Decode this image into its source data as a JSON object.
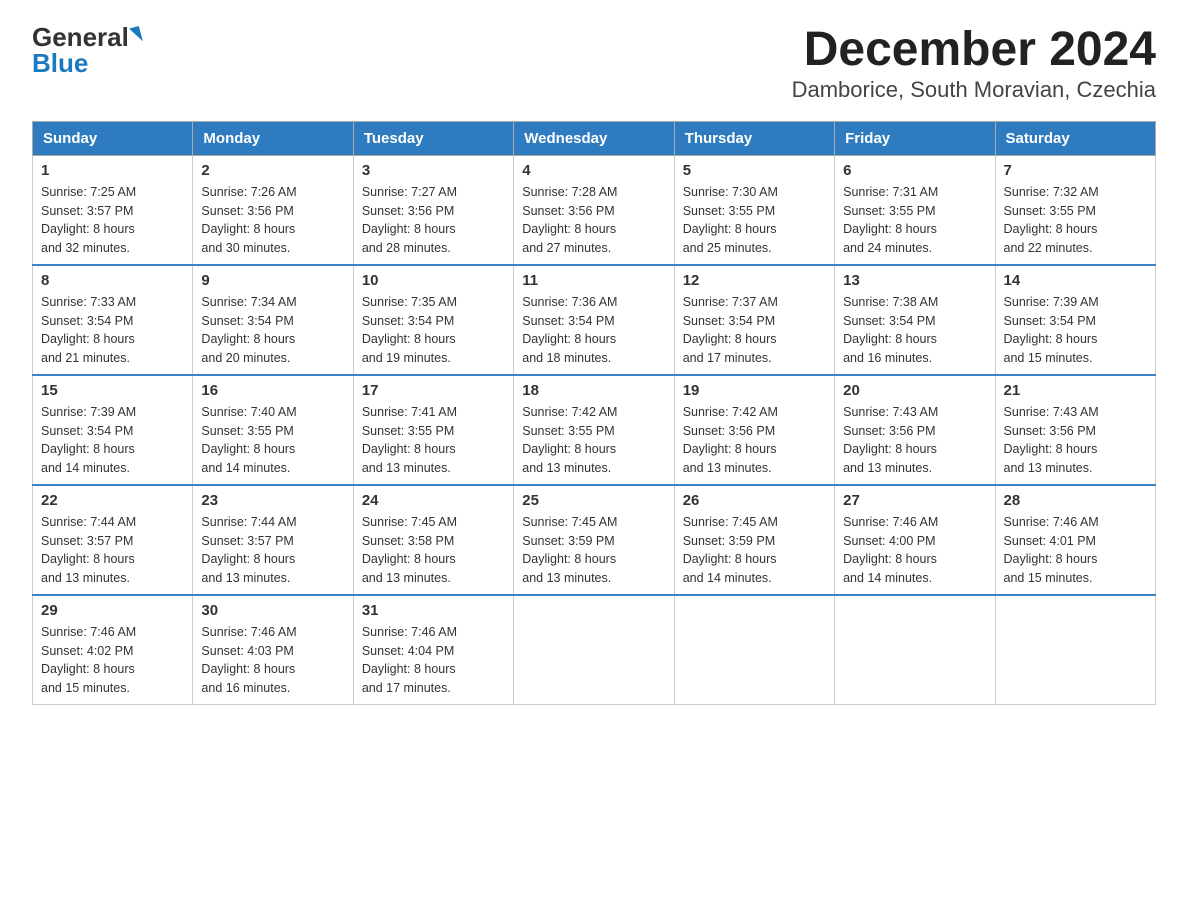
{
  "logo": {
    "general": "General",
    "blue": "Blue"
  },
  "title": "December 2024",
  "subtitle": "Damborice, South Moravian, Czechia",
  "weekdays": [
    "Sunday",
    "Monday",
    "Tuesday",
    "Wednesday",
    "Thursday",
    "Friday",
    "Saturday"
  ],
  "weeks": [
    [
      {
        "day": "1",
        "sunrise": "7:25 AM",
        "sunset": "3:57 PM",
        "daylight": "8 hours and 32 minutes."
      },
      {
        "day": "2",
        "sunrise": "7:26 AM",
        "sunset": "3:56 PM",
        "daylight": "8 hours and 30 minutes."
      },
      {
        "day": "3",
        "sunrise": "7:27 AM",
        "sunset": "3:56 PM",
        "daylight": "8 hours and 28 minutes."
      },
      {
        "day": "4",
        "sunrise": "7:28 AM",
        "sunset": "3:56 PM",
        "daylight": "8 hours and 27 minutes."
      },
      {
        "day": "5",
        "sunrise": "7:30 AM",
        "sunset": "3:55 PM",
        "daylight": "8 hours and 25 minutes."
      },
      {
        "day": "6",
        "sunrise": "7:31 AM",
        "sunset": "3:55 PM",
        "daylight": "8 hours and 24 minutes."
      },
      {
        "day": "7",
        "sunrise": "7:32 AM",
        "sunset": "3:55 PM",
        "daylight": "8 hours and 22 minutes."
      }
    ],
    [
      {
        "day": "8",
        "sunrise": "7:33 AM",
        "sunset": "3:54 PM",
        "daylight": "8 hours and 21 minutes."
      },
      {
        "day": "9",
        "sunrise": "7:34 AM",
        "sunset": "3:54 PM",
        "daylight": "8 hours and 20 minutes."
      },
      {
        "day": "10",
        "sunrise": "7:35 AM",
        "sunset": "3:54 PM",
        "daylight": "8 hours and 19 minutes."
      },
      {
        "day": "11",
        "sunrise": "7:36 AM",
        "sunset": "3:54 PM",
        "daylight": "8 hours and 18 minutes."
      },
      {
        "day": "12",
        "sunrise": "7:37 AM",
        "sunset": "3:54 PM",
        "daylight": "8 hours and 17 minutes."
      },
      {
        "day": "13",
        "sunrise": "7:38 AM",
        "sunset": "3:54 PM",
        "daylight": "8 hours and 16 minutes."
      },
      {
        "day": "14",
        "sunrise": "7:39 AM",
        "sunset": "3:54 PM",
        "daylight": "8 hours and 15 minutes."
      }
    ],
    [
      {
        "day": "15",
        "sunrise": "7:39 AM",
        "sunset": "3:54 PM",
        "daylight": "8 hours and 14 minutes."
      },
      {
        "day": "16",
        "sunrise": "7:40 AM",
        "sunset": "3:55 PM",
        "daylight": "8 hours and 14 minutes."
      },
      {
        "day": "17",
        "sunrise": "7:41 AM",
        "sunset": "3:55 PM",
        "daylight": "8 hours and 13 minutes."
      },
      {
        "day": "18",
        "sunrise": "7:42 AM",
        "sunset": "3:55 PM",
        "daylight": "8 hours and 13 minutes."
      },
      {
        "day": "19",
        "sunrise": "7:42 AM",
        "sunset": "3:56 PM",
        "daylight": "8 hours and 13 minutes."
      },
      {
        "day": "20",
        "sunrise": "7:43 AM",
        "sunset": "3:56 PM",
        "daylight": "8 hours and 13 minutes."
      },
      {
        "day": "21",
        "sunrise": "7:43 AM",
        "sunset": "3:56 PM",
        "daylight": "8 hours and 13 minutes."
      }
    ],
    [
      {
        "day": "22",
        "sunrise": "7:44 AM",
        "sunset": "3:57 PM",
        "daylight": "8 hours and 13 minutes."
      },
      {
        "day": "23",
        "sunrise": "7:44 AM",
        "sunset": "3:57 PM",
        "daylight": "8 hours and 13 minutes."
      },
      {
        "day": "24",
        "sunrise": "7:45 AM",
        "sunset": "3:58 PM",
        "daylight": "8 hours and 13 minutes."
      },
      {
        "day": "25",
        "sunrise": "7:45 AM",
        "sunset": "3:59 PM",
        "daylight": "8 hours and 13 minutes."
      },
      {
        "day": "26",
        "sunrise": "7:45 AM",
        "sunset": "3:59 PM",
        "daylight": "8 hours and 14 minutes."
      },
      {
        "day": "27",
        "sunrise": "7:46 AM",
        "sunset": "4:00 PM",
        "daylight": "8 hours and 14 minutes."
      },
      {
        "day": "28",
        "sunrise": "7:46 AM",
        "sunset": "4:01 PM",
        "daylight": "8 hours and 15 minutes."
      }
    ],
    [
      {
        "day": "29",
        "sunrise": "7:46 AM",
        "sunset": "4:02 PM",
        "daylight": "8 hours and 15 minutes."
      },
      {
        "day": "30",
        "sunrise": "7:46 AM",
        "sunset": "4:03 PM",
        "daylight": "8 hours and 16 minutes."
      },
      {
        "day": "31",
        "sunrise": "7:46 AM",
        "sunset": "4:04 PM",
        "daylight": "8 hours and 17 minutes."
      },
      null,
      null,
      null,
      null
    ]
  ],
  "labels": {
    "sunrise": "Sunrise: ",
    "sunset": "Sunset: ",
    "daylight": "Daylight: "
  }
}
